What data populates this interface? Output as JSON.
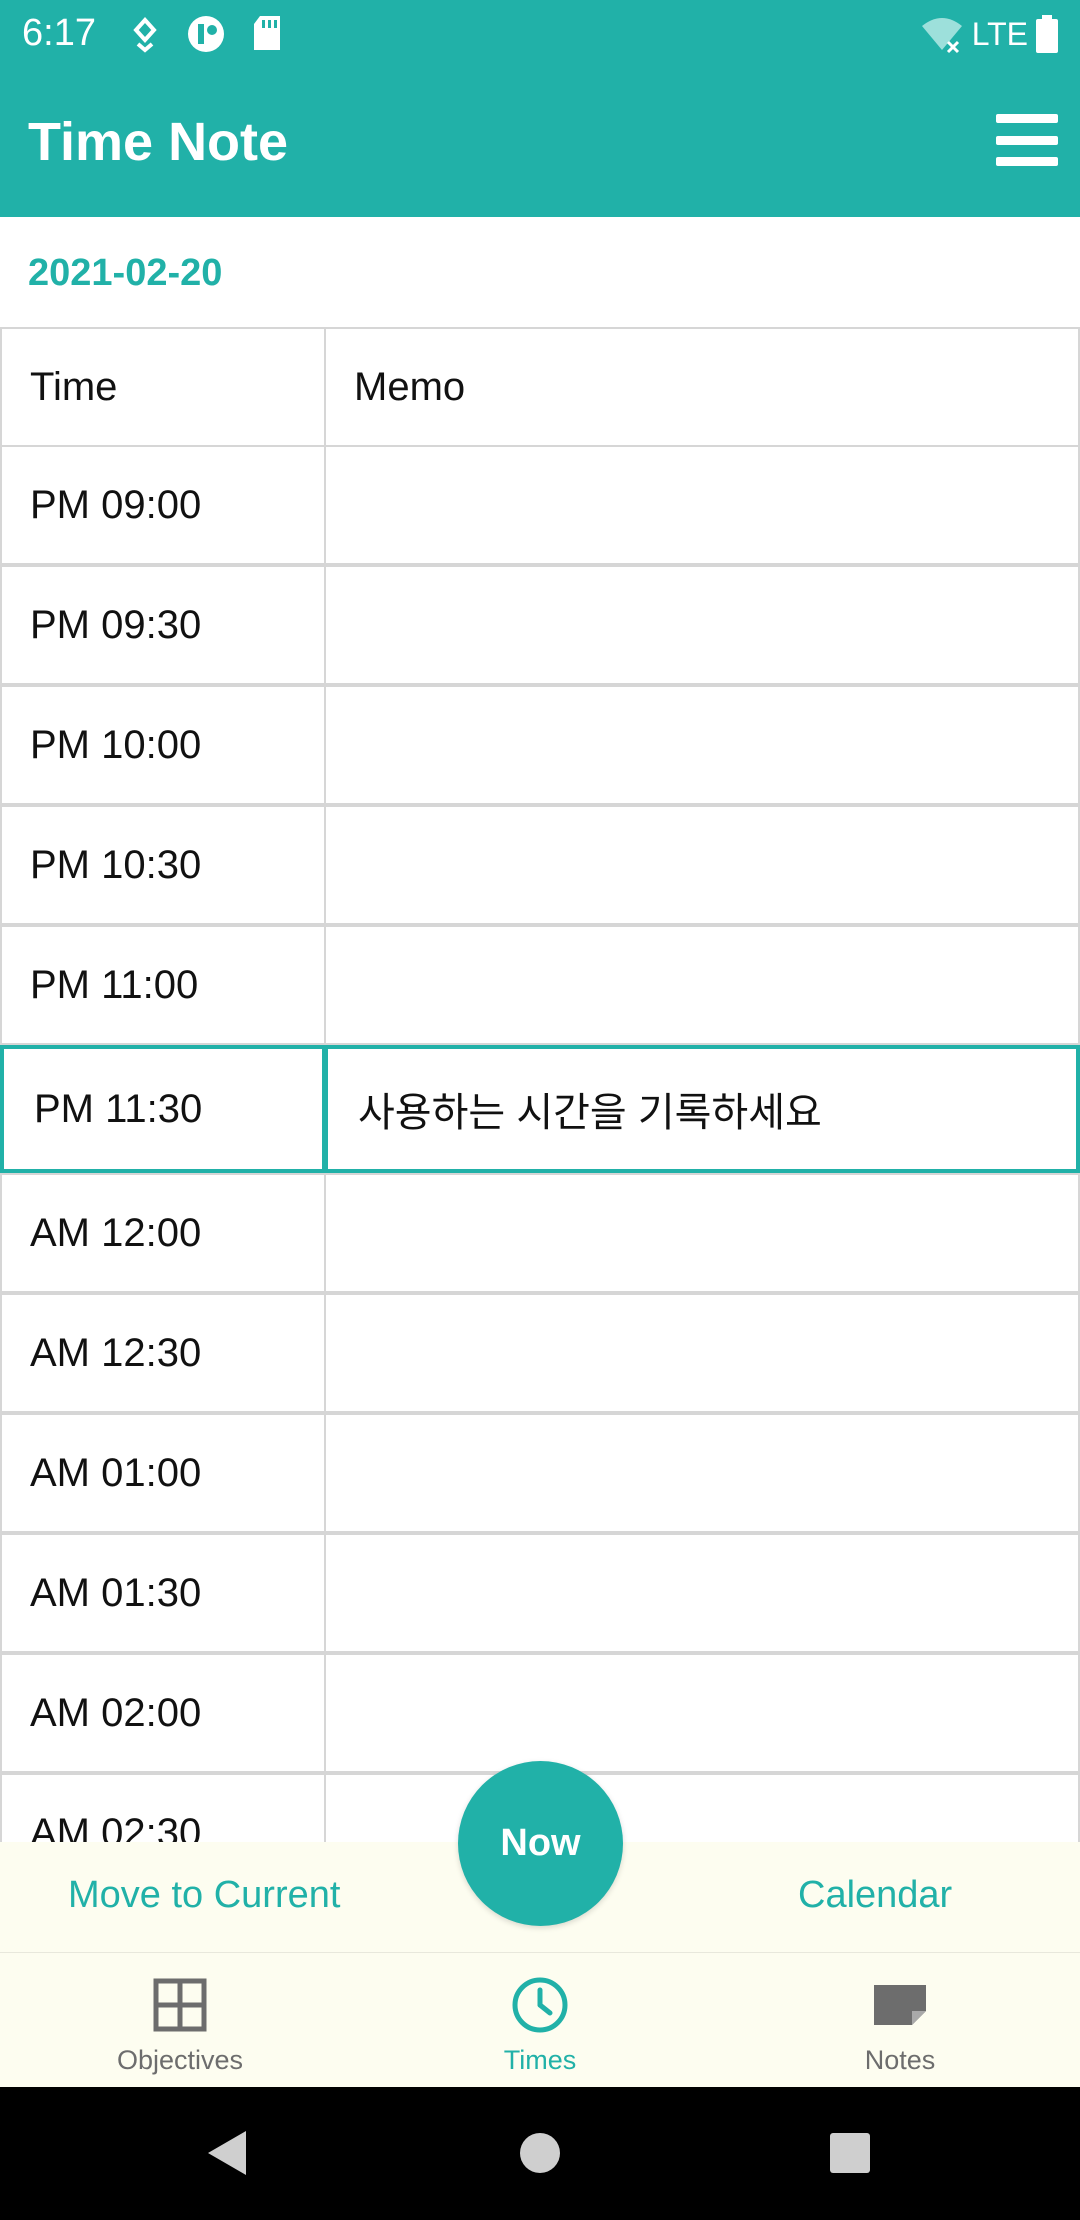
{
  "status_bar": {
    "time": "6:17",
    "network": "LTE"
  },
  "app_bar": {
    "title": "Time Note",
    "menu_icon": "hamburger-menu-icon"
  },
  "date": "2021-02-20",
  "table": {
    "headers": {
      "time": "Time",
      "memo": "Memo"
    },
    "rows": [
      {
        "time": "PM 09:00",
        "memo": ""
      },
      {
        "time": "PM 09:30",
        "memo": ""
      },
      {
        "time": "PM 10:00",
        "memo": ""
      },
      {
        "time": "PM 10:30",
        "memo": ""
      },
      {
        "time": "PM 11:00",
        "memo": ""
      },
      {
        "time": "PM 11:30",
        "memo": "사용하는 시간을 기록하세요"
      },
      {
        "time": "AM 12:00",
        "memo": ""
      },
      {
        "time": "AM 12:30",
        "memo": ""
      },
      {
        "time": "AM 01:00",
        "memo": ""
      },
      {
        "time": "AM 01:30",
        "memo": ""
      },
      {
        "time": "AM 02:00",
        "memo": ""
      },
      {
        "time": "AM 02:30",
        "memo": ""
      }
    ]
  },
  "actions": {
    "move_to_current": "Move to Current",
    "now": "Now",
    "calendar": "Calendar"
  },
  "bottom_nav": {
    "items": [
      {
        "label": "Objectives",
        "icon": "grid-icon"
      },
      {
        "label": "Times",
        "icon": "clock-icon",
        "active": true
      },
      {
        "label": "Notes",
        "icon": "note-icon"
      }
    ]
  },
  "colors": {
    "primary": "#21b1a8",
    "bar_background": "#fdfdf0",
    "inactive_nav": "#6d6d6d"
  }
}
